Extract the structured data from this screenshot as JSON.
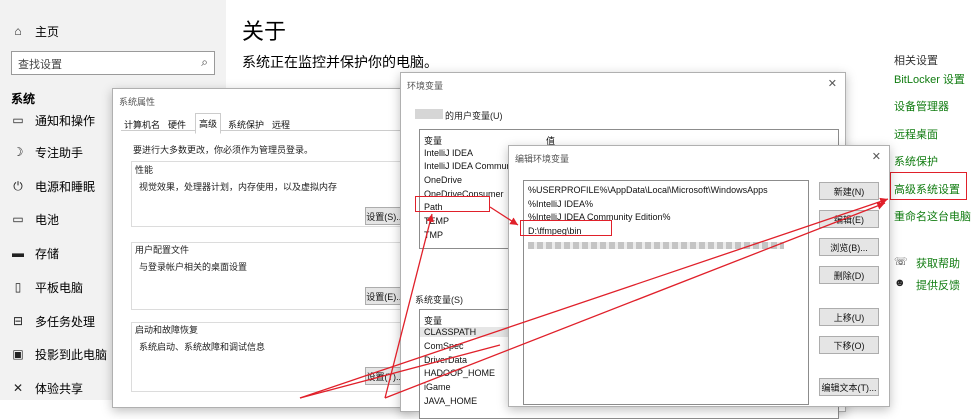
{
  "sidebar": {
    "home": {
      "icon": "home-icon",
      "label": "主页"
    },
    "search_placeholder": "查找设置",
    "section": "系统",
    "items": [
      {
        "icon": "notifications-icon",
        "label": "通知和操作"
      },
      {
        "icon": "moon-icon",
        "label": "专注助手"
      },
      {
        "icon": "power-icon",
        "label": "电源和睡眠"
      },
      {
        "icon": "battery-icon",
        "label": "电池"
      },
      {
        "icon": "storage-icon",
        "label": "存储"
      },
      {
        "icon": "tablet-icon",
        "label": "平板电脑"
      },
      {
        "icon": "multitask-icon",
        "label": "多任务处理"
      },
      {
        "icon": "project-icon",
        "label": "投影到此电脑"
      },
      {
        "icon": "share-icon",
        "label": "体验共享"
      }
    ]
  },
  "main": {
    "title": "关于",
    "subtitle": "系统正在监控并保护你的电脑。"
  },
  "related": {
    "heading": "相关设置",
    "links": [
      "BitLocker 设置",
      "设备管理器",
      "远程桌面",
      "系统保护",
      "高级系统设置",
      "重命名这台电脑"
    ],
    "help": "获取帮助",
    "feedback": "提供反馈"
  },
  "sysprops": {
    "title": "系统属性",
    "tabs": [
      "计算机名",
      "硬件",
      "高级",
      "系统保护",
      "远程"
    ],
    "admin_note": "要进行大多数更改，你必须作为管理员登录。",
    "perf": {
      "title": "性能",
      "desc": "视觉效果，处理器计划，内存使用，以及虚拟内存",
      "button": "设置(S)..."
    },
    "profile": {
      "title": "用户配置文件",
      "desc": "与登录帐户相关的桌面设置",
      "button": "设置(E)..."
    },
    "startup": {
      "title": "启动和故障恢复",
      "desc": "系统启动、系统故障和调试信息",
      "button": "设置(T)..."
    }
  },
  "envvars": {
    "title": "环境变量",
    "user_label": "的用户变量(U)",
    "col_var": "变量",
    "col_val": "值",
    "user_vars": [
      "IntelliJ IDEA",
      "IntelliJ IDEA Community...",
      "OneDrive",
      "OneDriveConsumer",
      "Path",
      "TEMP",
      "TMP"
    ],
    "sys_label": "系统变量(S)",
    "sys_vars": [
      "CLASSPATH",
      "ComSpec",
      "DriverData",
      "HADOOP_HOME",
      "iGame",
      "JAVA_HOME"
    ]
  },
  "editenv": {
    "title": "编辑环境变量",
    "entries": [
      "%USERPROFILE%\\AppData\\Local\\Microsoft\\WindowsApps",
      "%IntelliJ IDEA%",
      "%IntelliJ IDEA Community Edition%",
      "D:\\ffmpeg\\bin"
    ],
    "buttons": [
      "新建(N)",
      "编辑(E)",
      "浏览(B)...",
      "删除(D)",
      "上移(U)",
      "下移(O)",
      "编辑文本(T)..."
    ]
  },
  "colors": {
    "accent_green": "#107c10",
    "highlight_red": "#e0202a"
  }
}
